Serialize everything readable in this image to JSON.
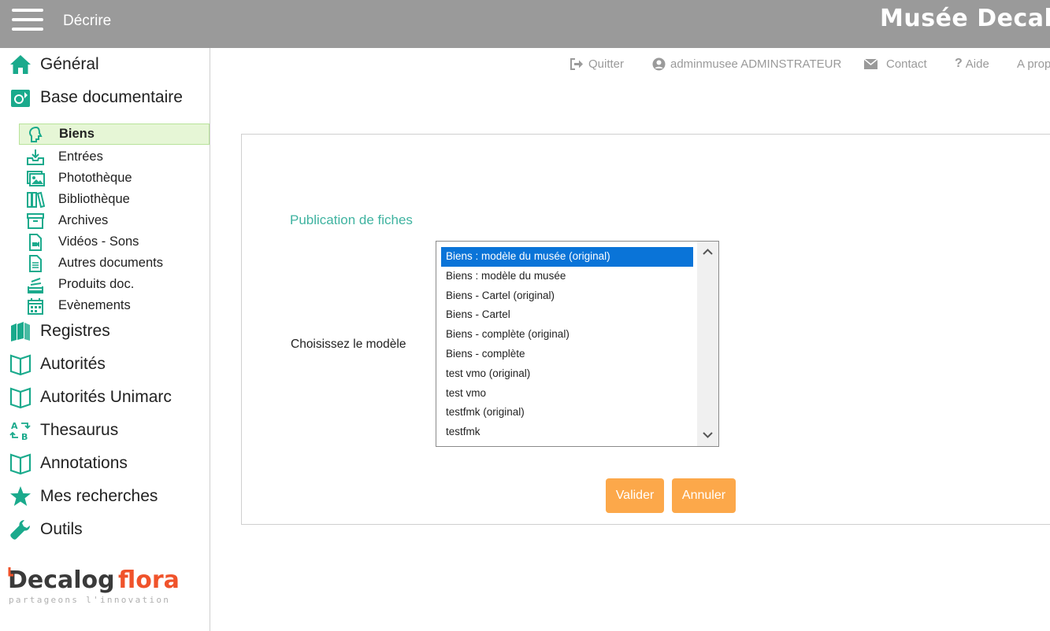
{
  "header": {
    "title": "Décrire",
    "app_name": "Musée Decalog"
  },
  "sidebar": {
    "items": [
      {
        "label": "Général",
        "icon": "home-icon"
      },
      {
        "label": "Base documentaire",
        "icon": "documents-base-icon"
      },
      {
        "label": "Registres",
        "icon": "registers-icon"
      },
      {
        "label": "Autorités",
        "icon": "book-icon"
      },
      {
        "label": "Autorités Unimarc",
        "icon": "book-icon"
      },
      {
        "label": "Thesaurus",
        "icon": "thesaurus-icon"
      },
      {
        "label": "Annotations",
        "icon": "book-icon"
      },
      {
        "label": "Mes recherches",
        "icon": "star-icon"
      },
      {
        "label": "Outils",
        "icon": "wrench-icon"
      }
    ],
    "subitems": [
      {
        "label": "Biens",
        "icon": "head-profile-icon",
        "active": true
      },
      {
        "label": "Entrées",
        "icon": "tray-download-icon"
      },
      {
        "label": "Photothèque",
        "icon": "photos-icon"
      },
      {
        "label": "Bibliothèque",
        "icon": "books-icon"
      },
      {
        "label": "Archives",
        "icon": "archive-box-icon"
      },
      {
        "label": "Vidéos - Sons",
        "icon": "video-file-icon"
      },
      {
        "label": "Autres documents",
        "icon": "document-icon"
      },
      {
        "label": "Produits doc.",
        "icon": "stack-icon"
      },
      {
        "label": "Evènements",
        "icon": "calendar-icon"
      }
    ],
    "logo": {
      "word1": "Decalog",
      "word2": "flora",
      "tagline": "partageons l'innovation"
    }
  },
  "toplinks": {
    "quit": "Quitter",
    "user": "adminmusee ADMINSTRATEUR",
    "contact": "Contact",
    "help": "Aide",
    "about": "A propos"
  },
  "main": {
    "section_title": "Publication de fiches",
    "field_label": "Choisissez le modèle",
    "options": [
      "Biens : modèle du musée (original)",
      "Biens : modèle du musée",
      "Biens - Cartel (original)",
      "Biens - Cartel",
      "Biens - complète (original)",
      "Biens - complète",
      "test vmo (original)",
      "test vmo",
      "testfmk (original)",
      "testfmk"
    ],
    "selected_index": 0,
    "validate_label": "Valider",
    "cancel_label": "Annuler"
  },
  "colors": {
    "header_bg": "#9a9a9a",
    "accent_green": "#1aaa8c",
    "section_title": "#3fb3a0",
    "button_orange": "#fca84a",
    "selected_blue": "#0a74d8",
    "active_item_bg": "#e6f6d6"
  }
}
